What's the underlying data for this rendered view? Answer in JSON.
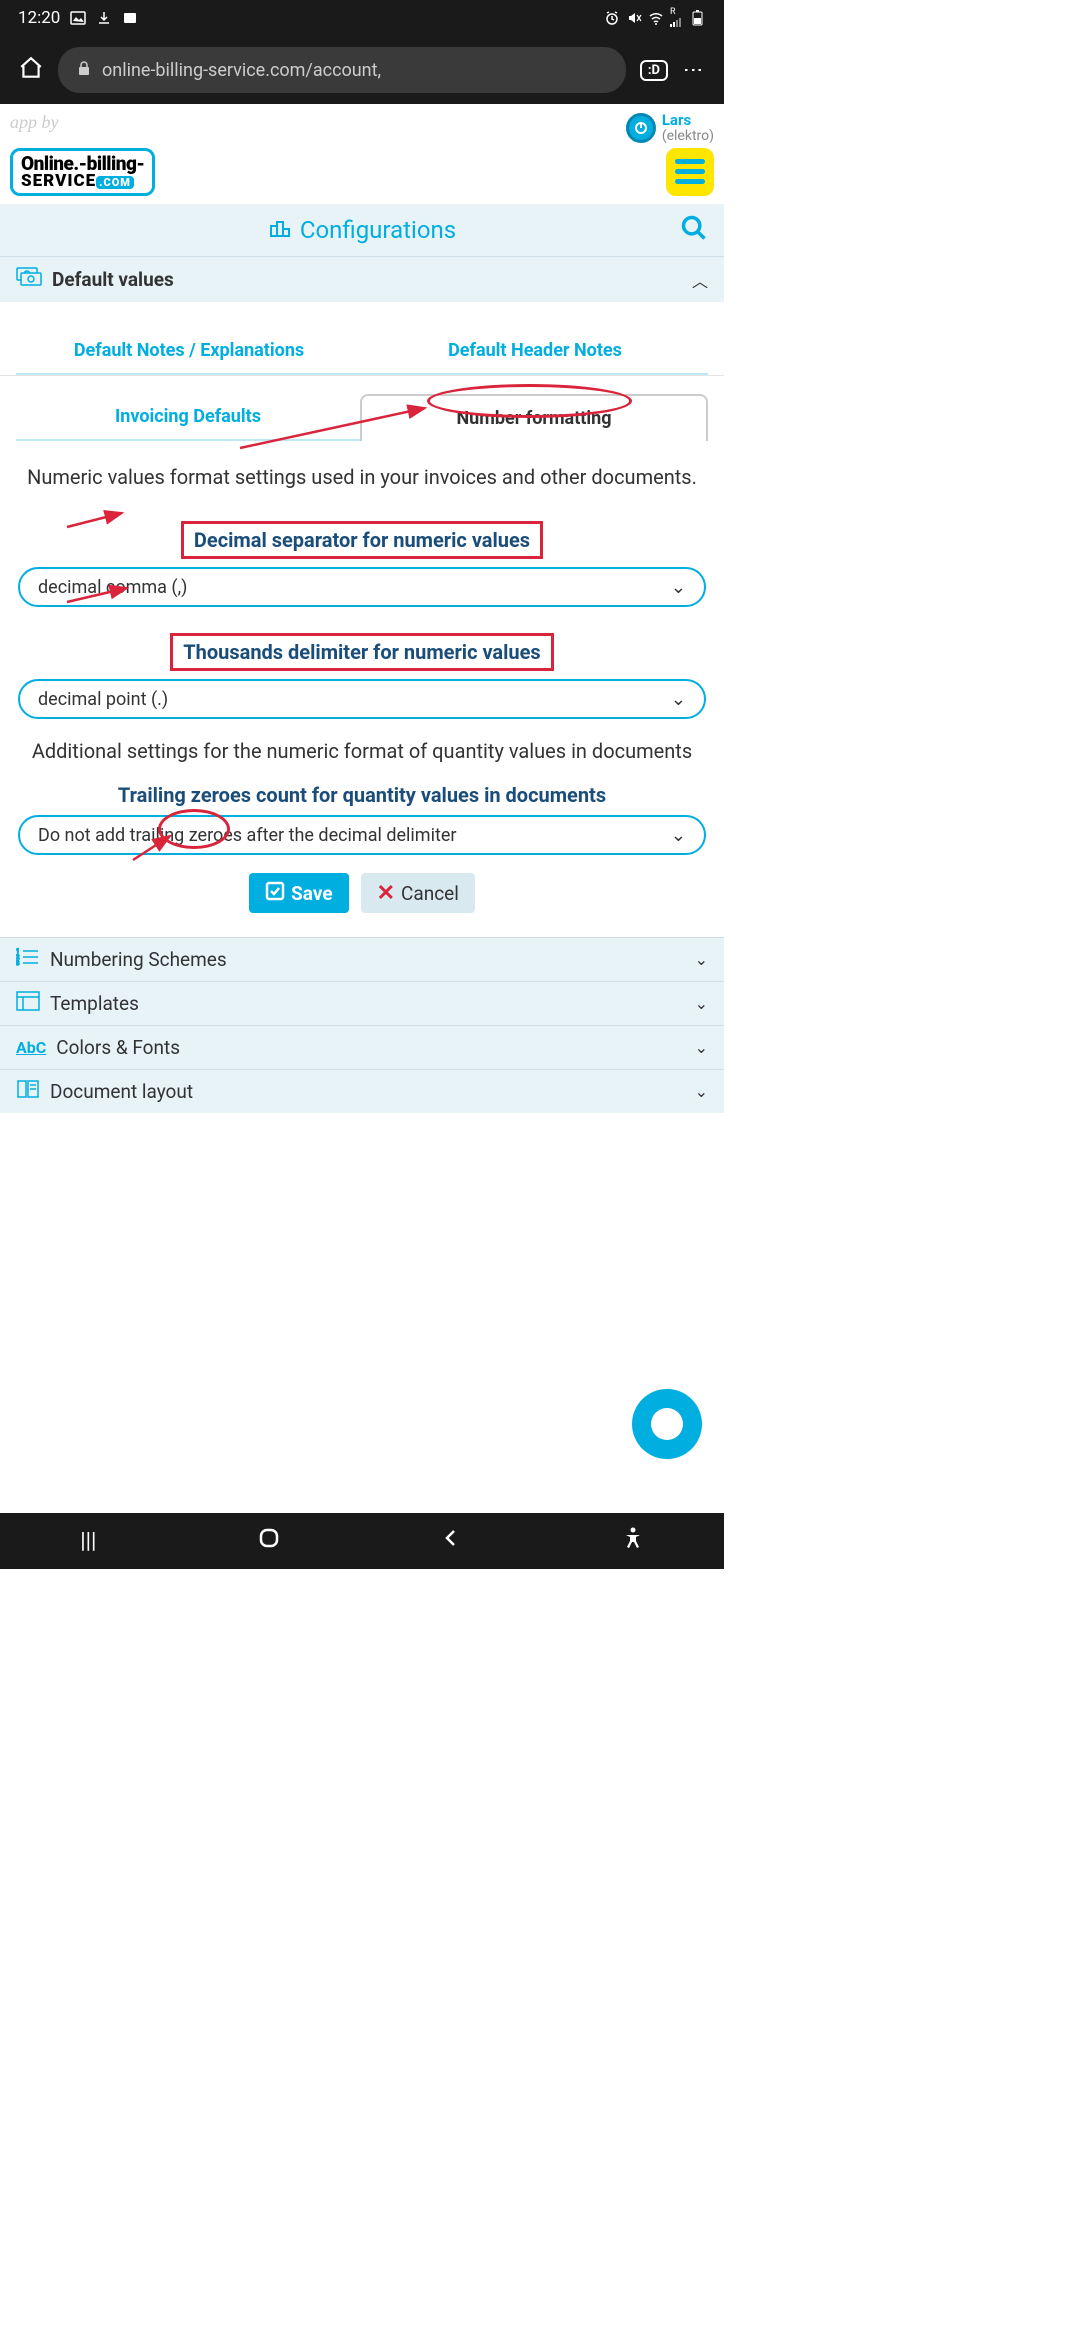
{
  "status": {
    "time": "12:20"
  },
  "browser": {
    "url": "online-billing-service.com/account,",
    "tabs_badge": ":D"
  },
  "header": {
    "app_by": "app by",
    "user_name": "Lars",
    "user_company": "(elektro)",
    "logo_l1": "Online.-billing-",
    "logo_l2": "SeRVice",
    "logo_com": ".com"
  },
  "config": {
    "title": "Configurations"
  },
  "sections": {
    "default_values": "Default values",
    "numbering": "Numbering Schemes",
    "templates": "Templates",
    "colors": "Colors & Fonts",
    "layout": "Document layout"
  },
  "tabs": {
    "notes": "Default Notes / Explanations",
    "header_notes": "Default Header Notes",
    "invoicing": "Invoicing Defaults",
    "number_fmt": "Number formatting"
  },
  "form": {
    "desc": "Numeric values format settings used in your invoices and other documents.",
    "decimal_label": "Decimal separator for numeric values",
    "decimal_value": "decimal comma (,)",
    "thousands_label": "Thousands delimiter for numeric values",
    "thousands_value": "decimal point (.)",
    "desc2": "Additional settings for the numeric format of quantity values in documents",
    "trailing_label": "Trailing zeroes count for quantity values in documents",
    "trailing_value": "Do not add trailing zeroes after the decimal delimiter",
    "save": "Save",
    "cancel": "Cancel"
  }
}
